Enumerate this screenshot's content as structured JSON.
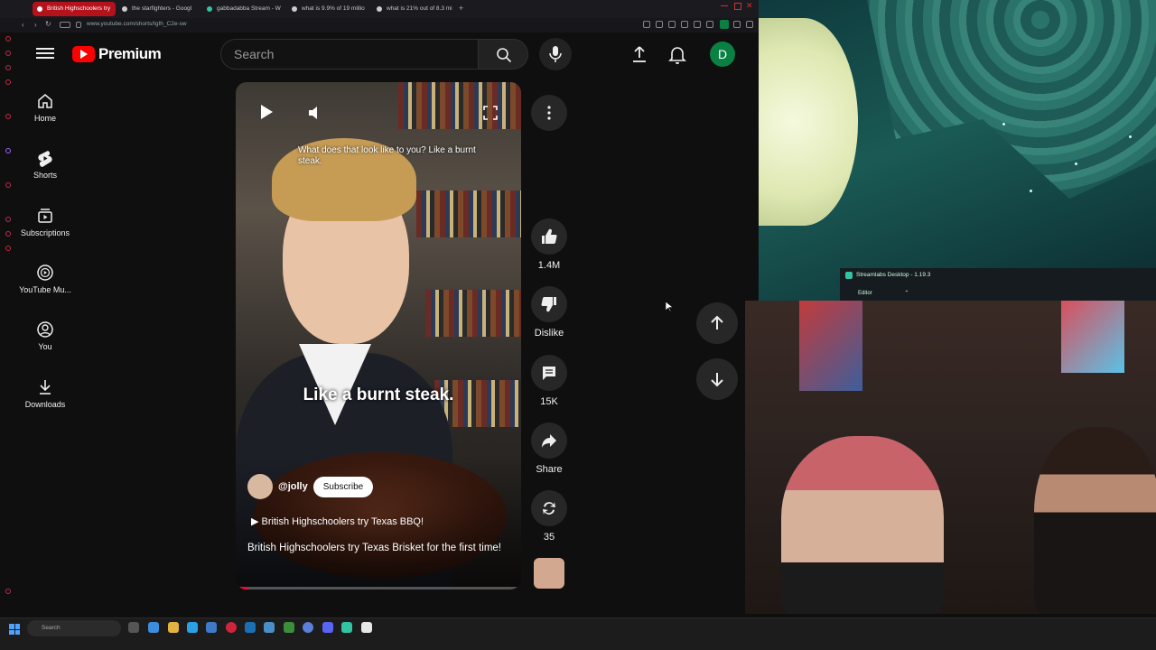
{
  "browser": {
    "tabs": [
      {
        "label": "British Highschoolers try",
        "active": true
      },
      {
        "label": "the starfighters - Googl",
        "active": false
      },
      {
        "label": "gabbadabba Stream - W",
        "active": false
      },
      {
        "label": "what is 9.9% of 19 millio",
        "active": false
      },
      {
        "label": "what is 21% out of 8.3 mi",
        "active": false
      }
    ],
    "url": "www.youtube.com/shorts/IgIh_C2e-sw",
    "new_tab_glyph": "+"
  },
  "youtube": {
    "logo_text": "Premium",
    "search_placeholder": "Search",
    "avatar_letter": "D",
    "sidebar": [
      {
        "label": "Home",
        "icon": "home-icon"
      },
      {
        "label": "Shorts",
        "icon": "shorts-icon"
      },
      {
        "label": "Subscriptions",
        "icon": "subscriptions-icon"
      },
      {
        "label": "YouTube Mu...",
        "icon": "youtube-music-icon"
      },
      {
        "label": "You",
        "icon": "you-icon"
      },
      {
        "label": "Downloads",
        "icon": "downloads-icon"
      }
    ],
    "short": {
      "caption_top": "What does that look like to you? Like a burnt steak.",
      "caption_big": "Like a burnt steak.",
      "channel": "@jolly",
      "subscribe_label": "Subscribe",
      "music": "British Highschoolers try Texas BBQ!",
      "description": "British Highschoolers try Texas Brisket for the first time!",
      "progress": 0.04
    },
    "actions": {
      "likes": "1.4M",
      "dislike_label": "Dislike",
      "comments": "15K",
      "share_label": "Share",
      "remix_count": "35"
    }
  },
  "streamlabs": {
    "title": "Streamlabs Desktop - 1.19.3",
    "editor_label": "Editor"
  },
  "taskbar": {
    "search_placeholder": "Search"
  },
  "colors": {
    "yt_red": "#ff0000",
    "bg": "#0f0f0f",
    "avatar": "#0b8043",
    "active_tab": "#b5121b"
  }
}
